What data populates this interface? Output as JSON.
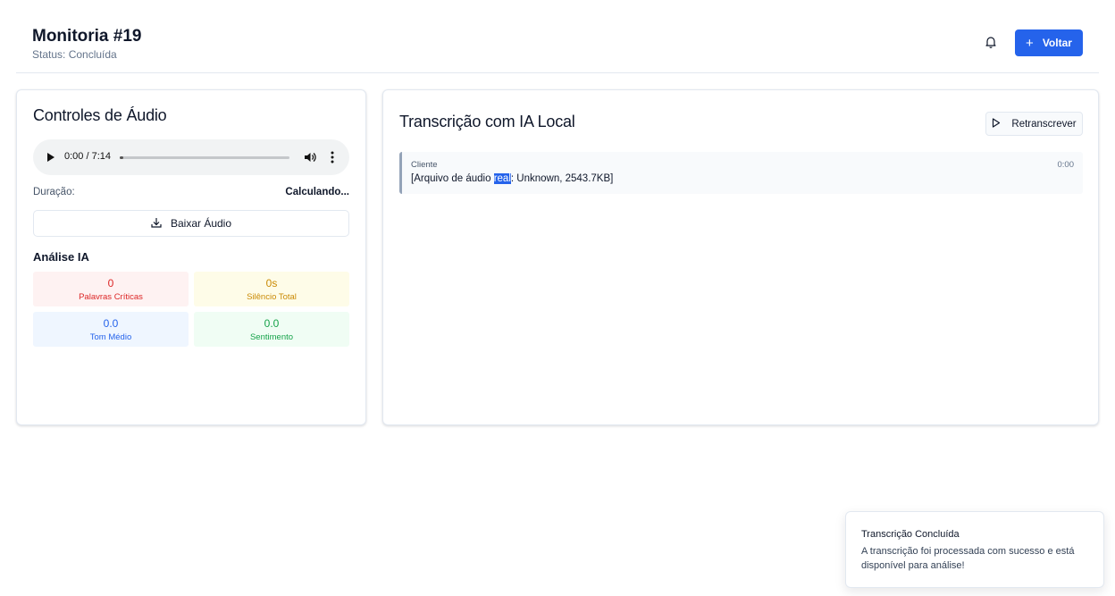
{
  "header": {
    "title": "Monitoria #19",
    "status": "Status: Concluída",
    "back_button_label": "Voltar",
    "notification_icon": "bell-icon",
    "back_button_icon": "plus-icon"
  },
  "audio_card": {
    "title": "Controles de Áudio",
    "player": {
      "time": "0:00 / 7:14",
      "progress": 0.0
    },
    "duration_label": "Duração:",
    "duration_value": "Calculando...",
    "download_label": "Baixar Áudio",
    "download_icon": "download-icon"
  },
  "analysis": {
    "title": "Análise IA",
    "stats": [
      {
        "value": "0",
        "label": "Palavras Críticas",
        "color": "#dc2626"
      },
      {
        "value": "0s",
        "label": "Silêncio Total",
        "color": "#ca8a04"
      },
      {
        "value": "0.0",
        "label": "Tom Médio",
        "color": "#2563eb"
      },
      {
        "value": "0.0",
        "label": "Sentimento",
        "color": "#16a34a"
      }
    ]
  },
  "transcription_card": {
    "title": "Transcrição com IA Local",
    "retranscribe_label": "Retranscrever",
    "retranscribe_icon": "play-outline-icon",
    "segments": [
      {
        "speaker": "Cliente",
        "time": "0:00",
        "text_before": "[Arquivo de áudio ",
        "text_highlight": "real",
        "text_after": ": Unknown, 2543.7KB]"
      }
    ]
  },
  "toast": {
    "title": "Transcrição Concluída",
    "body": "A transcrição foi processada com sucesso e está disponível para análise!"
  },
  "colors": {
    "primary": "#2563eb",
    "border": "#e2e8f0",
    "muted_text": "#64748b"
  }
}
